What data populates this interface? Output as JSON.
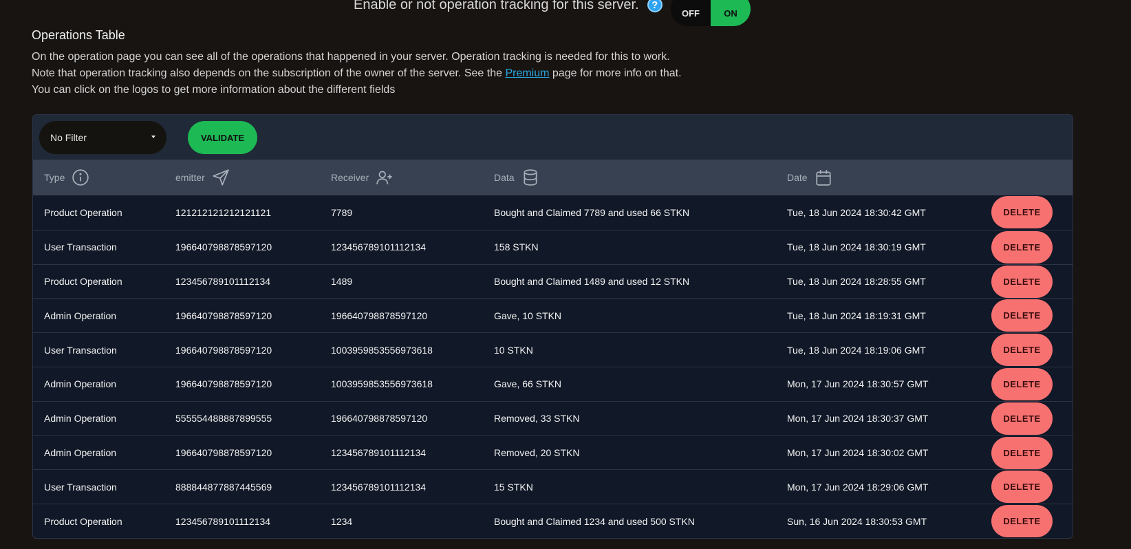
{
  "tracking": {
    "question": "Enable or not operation tracking for this server.",
    "help_icon": "question-circle-icon",
    "off_label": "OFF",
    "on_label": "ON"
  },
  "section": {
    "title": "Operations Table",
    "line1": "On the operation page you can see all of the operations that happened in your server. Operation tracking is needed for this to work.",
    "line2_before": "Note that operation tracking also depends on the subscription of the owner of the server. See the ",
    "line2_link": "Premium",
    "line2_after": " page for more info on that.",
    "line3": "You can click on the logos to get more information about the different fields"
  },
  "toolbar": {
    "filter_value": "No Filter",
    "validate_label": "VALIDATE"
  },
  "table": {
    "headers": [
      {
        "label": "Type",
        "icon": "info-icon"
      },
      {
        "label": "emitter",
        "icon": "send-icon"
      },
      {
        "label": "Receiver",
        "icon": "user-plus-icon"
      },
      {
        "label": "Data",
        "icon": "database-icon"
      },
      {
        "label": "Date",
        "icon": "calendar-icon"
      }
    ],
    "delete_label": "DELETE",
    "rows": [
      {
        "type": "Product Operation",
        "emitter": "121212121212121121",
        "receiver": "7789",
        "data": "Bought and Claimed 7789 and used 66 STKN",
        "date": "Tue, 18 Jun 2024 18:30:42 GMT"
      },
      {
        "type": "User Transaction",
        "emitter": "196640798878597120",
        "receiver": "123456789101112134",
        "data": "158 STKN",
        "date": "Tue, 18 Jun 2024 18:30:19 GMT"
      },
      {
        "type": "Product Operation",
        "emitter": "123456789101112134",
        "receiver": "1489",
        "data": "Bought and Claimed 1489 and used 12 STKN",
        "date": "Tue, 18 Jun 2024 18:28:55 GMT"
      },
      {
        "type": "Admin Operation",
        "emitter": "196640798878597120",
        "receiver": "196640798878597120",
        "data": "Gave, 10 STKN",
        "date": "Tue, 18 Jun 2024 18:19:31 GMT"
      },
      {
        "type": "User Transaction",
        "emitter": "196640798878597120",
        "receiver": "1003959853556973618",
        "data": "10 STKN",
        "date": "Tue, 18 Jun 2024 18:19:06 GMT"
      },
      {
        "type": "Admin Operation",
        "emitter": "196640798878597120",
        "receiver": "1003959853556973618",
        "data": "Gave, 66 STKN",
        "date": "Mon, 17 Jun 2024 18:30:57 GMT"
      },
      {
        "type": "Admin Operation",
        "emitter": "555554488887899555",
        "receiver": "196640798878597120",
        "data": "Removed, 33 STKN",
        "date": "Mon, 17 Jun 2024 18:30:37 GMT"
      },
      {
        "type": "Admin Operation",
        "emitter": "196640798878597120",
        "receiver": "123456789101112134",
        "data": "Removed, 20 STKN",
        "date": "Mon, 17 Jun 2024 18:30:02 GMT"
      },
      {
        "type": "User Transaction",
        "emitter": "888844877887445569",
        "receiver": "123456789101112134",
        "data": "15 STKN",
        "date": "Mon, 17 Jun 2024 18:29:06 GMT"
      },
      {
        "type": "Product Operation",
        "emitter": "123456789101112134",
        "receiver": "1234",
        "data": "Bought and Claimed 1234 and used 500 STKN",
        "date": "Sun, 16 Jun 2024 18:30:53 GMT"
      }
    ]
  }
}
